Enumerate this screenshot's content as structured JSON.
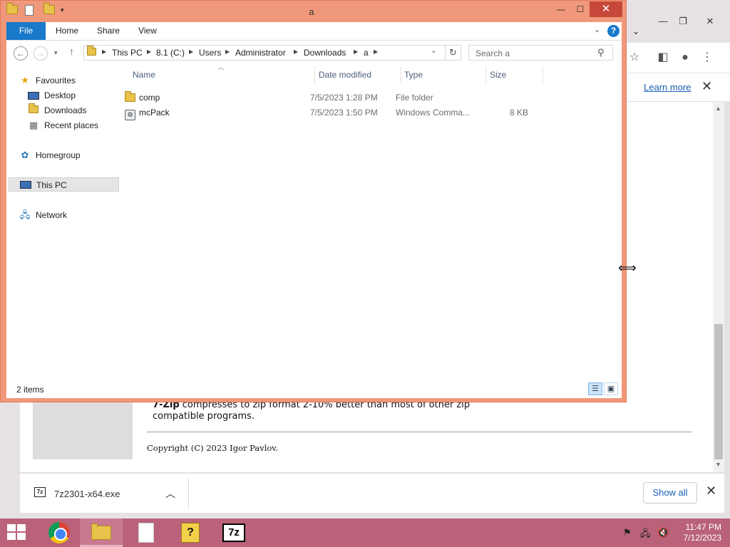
{
  "explorer": {
    "title": "a",
    "ribbon_tabs": [
      "File",
      "Home",
      "Share",
      "View"
    ],
    "address": [
      "This PC",
      "8.1 (C:)",
      "Users",
      "Administrator",
      "Downloads",
      "a"
    ],
    "search_placeholder": "Search a",
    "nav": {
      "favourites": "Favourites",
      "desktop": "Desktop",
      "downloads": "Downloads",
      "recent": "Recent places",
      "homegroup": "Homegroup",
      "this_pc": "This PC",
      "network": "Network"
    },
    "columns": [
      "Name",
      "Date modified",
      "Type",
      "Size"
    ],
    "files": [
      {
        "name": "comp",
        "date": "7/5/2023 1:28 PM",
        "type": "File folder",
        "size": "",
        "icon": "folder-icon"
      },
      {
        "name": "mcPack",
        "date": "7/5/2023 1:50 PM",
        "type": "Windows Comma...",
        "size": "8 KB",
        "icon": "cmd-file-icon"
      }
    ],
    "status": "2 items"
  },
  "browser": {
    "learn_more": "Learn more",
    "page_text_bold": "7-Zip",
    "page_text_rest": " compresses to zip format 2-10% better than most of other zip compatible programs.",
    "copyright": "Copyright (C) 2023 Igor Pavlov.",
    "download_file": "7z2301-x64.exe",
    "show_all": "Show all"
  },
  "taskbar": {
    "time": "11:47 PM",
    "date": "7/12/2023",
    "seven_zip_label": "7z"
  },
  "colors": {
    "explorer_frame": "#f0987b",
    "accent_blue": "#1979ca",
    "close_red": "#c7473a",
    "taskbar": "#b9627a"
  }
}
